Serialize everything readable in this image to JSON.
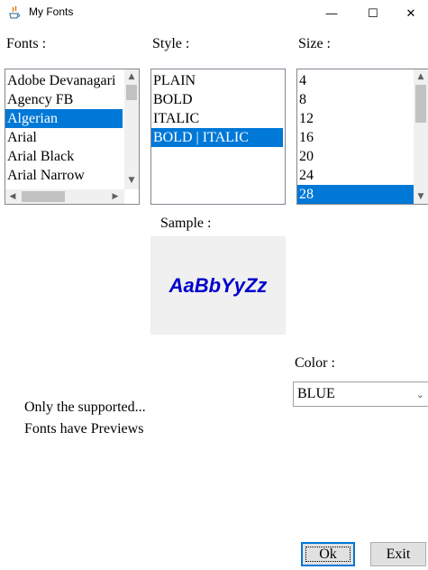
{
  "window": {
    "title": "My Fonts",
    "minimize_glyph": "—",
    "maximize_glyph": "☐",
    "close_glyph": "✕"
  },
  "labels": {
    "fonts": "Fonts :",
    "style": "Style :",
    "size": "Size :",
    "sample": "Sample :",
    "color": "Color :"
  },
  "fonts_list": {
    "items": [
      "Adobe Devanagari",
      "Agency FB",
      "Algerian",
      "Arial",
      "Arial Black",
      "Arial Narrow"
    ],
    "selected": "Algerian"
  },
  "style_list": {
    "items": [
      "PLAIN",
      "BOLD",
      "ITALIC",
      "BOLD | ITALIC"
    ],
    "selected": "BOLD | ITALIC"
  },
  "size_list": {
    "items": [
      "4",
      "8",
      "12",
      "16",
      "20",
      "24",
      "28"
    ],
    "selected": "28"
  },
  "sample": {
    "text": "AaBbYyZz",
    "color": "#0000cc"
  },
  "color_select": {
    "value": "BLUE"
  },
  "note": {
    "line1": "Only the supported...",
    "line2": "Fonts have Previews"
  },
  "buttons": {
    "ok": "Ok",
    "exit": "Exit"
  },
  "theme": {
    "selection": "#0078d7"
  }
}
